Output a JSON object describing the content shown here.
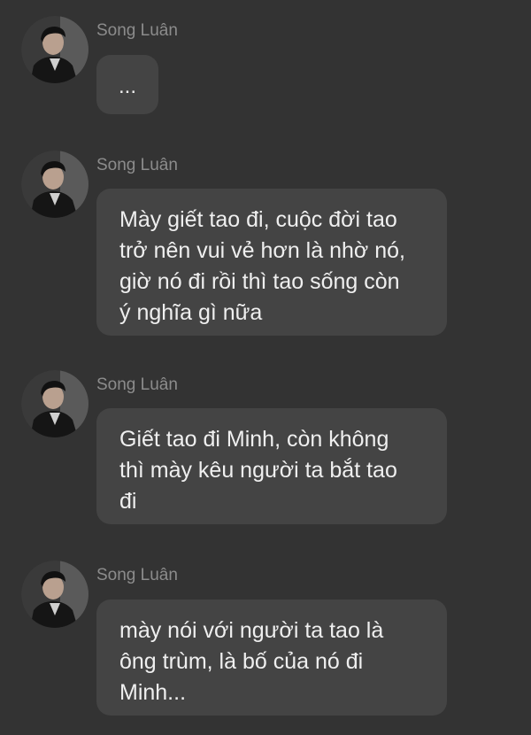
{
  "messages": [
    {
      "sender": "Song Luân",
      "text": "..."
    },
    {
      "sender": "Song Luân",
      "text": "Mày giết tao đi, cuộc đời tao\ntrở nên vui vẻ hơn là nhờ nó,\ngiờ nó đi rồi thì tao sống còn\ný nghĩa gì nữa"
    },
    {
      "sender": "Song Luân",
      "text": "Giết tao đi Minh, còn không\nthì mày kêu người ta bắt tao\nđi"
    },
    {
      "sender": "Song Luân",
      "text": "mày nói với người ta tao là\nông trùm, là bố của nó đi\nMinh..."
    }
  ],
  "colors": {
    "background": "#333333",
    "bubble": "#444444",
    "sender_name": "#8c8c8c",
    "message_text": "#efefef"
  },
  "icons": {
    "avatar": "profile-photo-avatar"
  }
}
